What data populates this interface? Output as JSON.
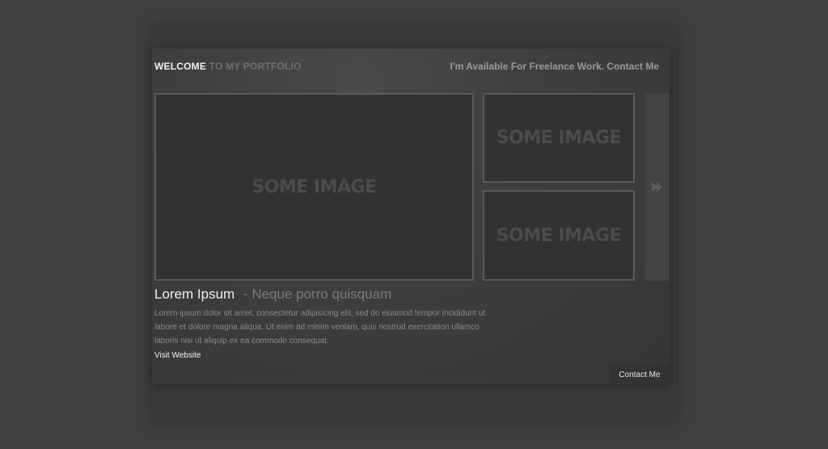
{
  "header": {
    "welcome_bold": "WELCOME",
    "welcome_rest": "TO MY PORTFOLIO",
    "availability": "I'm Available For Freelance Work. Contact Me"
  },
  "gallery": {
    "main_image_label": "SOME IMAGE",
    "side_image_1_label": "SOME IMAGE",
    "side_image_2_label": "SOME IMAGE",
    "next_icon": "play-arrow-icon"
  },
  "project": {
    "title": "Lorem Ipsum",
    "subtitle": "- Neque porro quisquam",
    "description": "Lorem ipsum dolor sit amet, consectetur adipisicing elit, sed do eiusmod tempor incididunt ut labore et dolore magna aliqua. Ut enim ad minim veniam, quis nostrud exercitation ullamco laboris nisi ut aliquip ex ea commodo consequat.",
    "visit_label": "Visit Website"
  },
  "footer": {
    "contact_label": "Contact Me"
  },
  "colors": {
    "background": "#3f3f3f",
    "panel": "#3e3e3e",
    "accent_text": "#f2f2f2",
    "muted_text": "#8a8a8a"
  }
}
